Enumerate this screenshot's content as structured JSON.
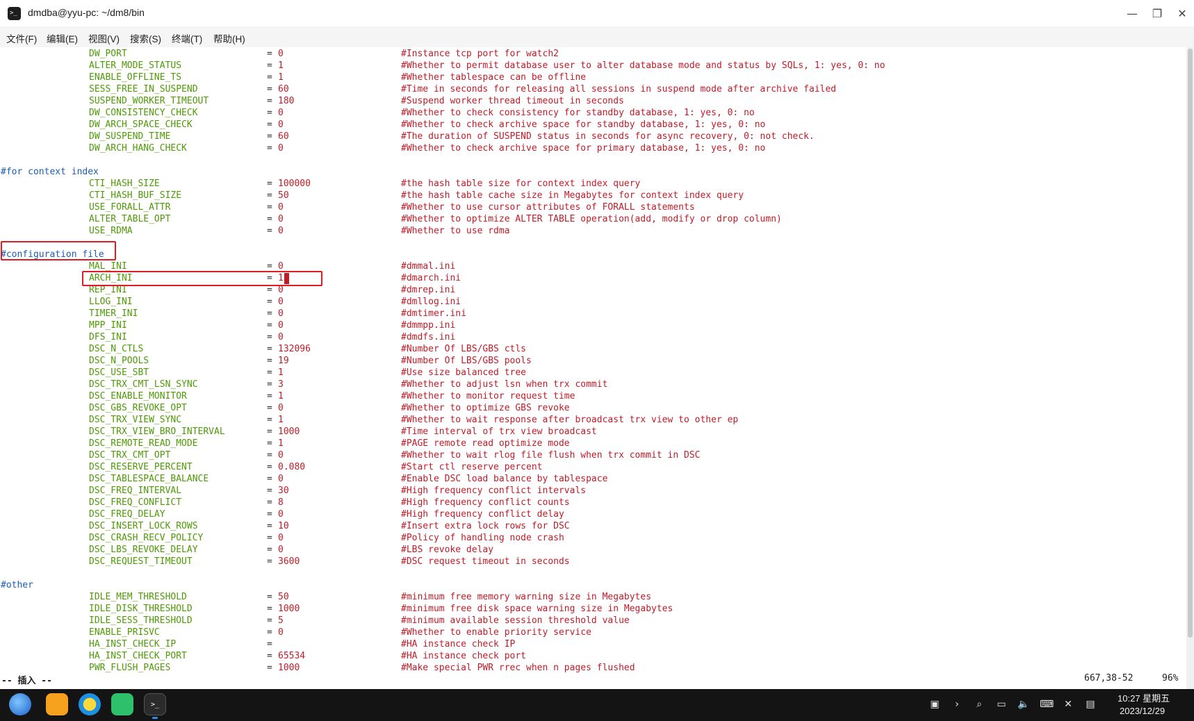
{
  "window": {
    "title": "dmdba@yyu-pc: ~/dm8/bin",
    "minimize_glyph": "—",
    "maximize_glyph": "❐",
    "close_glyph": "✕"
  },
  "menu": [
    "文件(F)",
    "编辑(E)",
    "视图(V)",
    "搜索(S)",
    "终端(T)",
    "帮助(H)"
  ],
  "lines": [
    {
      "name": "DW_PORT",
      "value": "0",
      "comment": "#Instance tcp port for watch2"
    },
    {
      "name": "ALTER_MODE_STATUS",
      "value": "1",
      "comment": "#Whether to permit database user to alter database mode and status by SQLs, 1: yes, 0: no"
    },
    {
      "name": "ENABLE_OFFLINE_TS",
      "value": "1",
      "comment": "#Whether tablespace can be offline"
    },
    {
      "name": "SESS_FREE_IN_SUSPEND",
      "value": "60",
      "comment": "#Time in seconds for releasing all sessions in suspend mode after archive failed"
    },
    {
      "name": "SUSPEND_WORKER_TIMEOUT",
      "value": "180",
      "comment": "#Suspend worker thread timeout in seconds"
    },
    {
      "name": "DW_CONSISTENCY_CHECK",
      "value": "0",
      "comment": "#Whether to check consistency for standby database, 1: yes, 0: no"
    },
    {
      "name": "DW_ARCH_SPACE_CHECK",
      "value": "0",
      "comment": "#Whether to check archive space for standby database, 1: yes, 0: no"
    },
    {
      "name": "DW_SUSPEND_TIME",
      "value": "60",
      "comment": "#The duration of SUSPEND status in seconds for async recovery, 0: not check."
    },
    {
      "name": "DW_ARCH_HANG_CHECK",
      "value": "0",
      "comment": "#Whether to check archive space for primary database, 1: yes, 0: no"
    },
    {
      "blank": true
    },
    {
      "section": "#for context index"
    },
    {
      "name": "CTI_HASH_SIZE",
      "value": "100000",
      "comment": "#the hash table size for context index query"
    },
    {
      "name": "CTI_HASH_BUF_SIZE",
      "value": "50",
      "comment": "#the hash table cache size in Megabytes for context index query"
    },
    {
      "name": "USE_FORALL_ATTR",
      "value": "0",
      "comment": "#Whether to use cursor attributes of FORALL statements"
    },
    {
      "name": "ALTER_TABLE_OPT",
      "value": "0",
      "comment": "#Whether to optimize ALTER TABLE operation(add, modify or drop column)"
    },
    {
      "name": "USE_RDMA",
      "value": "0",
      "comment": "#Whether to use rdma"
    },
    {
      "blank": true
    },
    {
      "section": "#configuration file"
    },
    {
      "name": "MAL_INI",
      "value": "0",
      "comment": "#dmmal.ini"
    },
    {
      "name": "ARCH_INI",
      "value": "1",
      "comment": "#dmarch.ini"
    },
    {
      "name": "REP_INI",
      "value": "0",
      "comment": "#dmrep.ini"
    },
    {
      "name": "LLOG_INI",
      "value": "0",
      "comment": "#dmllog.ini"
    },
    {
      "name": "TIMER_INI",
      "value": "0",
      "comment": "#dmtimer.ini"
    },
    {
      "name": "MPP_INI",
      "value": "0",
      "comment": "#dmmpp.ini"
    },
    {
      "name": "DFS_INI",
      "value": "0",
      "comment": "#dmdfs.ini"
    },
    {
      "name": "DSC_N_CTLS",
      "value": "132096",
      "comment": "#Number Of LBS/GBS ctls"
    },
    {
      "name": "DSC_N_POOLS",
      "value": "19",
      "comment": "#Number Of LBS/GBS pools"
    },
    {
      "name": "DSC_USE_SBT",
      "value": "1",
      "comment": "#Use size balanced tree"
    },
    {
      "name": "DSC_TRX_CMT_LSN_SYNC",
      "value": "3",
      "comment": "#Whether to adjust lsn when trx commit"
    },
    {
      "name": "DSC_ENABLE_MONITOR",
      "value": "1",
      "comment": "#Whether to monitor request time"
    },
    {
      "name": "DSC_GBS_REVOKE_OPT",
      "value": "0",
      "comment": "#Whether to optimize GBS revoke"
    },
    {
      "name": "DSC_TRX_VIEW_SYNC",
      "value": "1",
      "comment": "#Whether to wait response after broadcast trx view to other ep"
    },
    {
      "name": "DSC_TRX_VIEW_BRO_INTERVAL",
      "value": "1000",
      "comment": "#Time interval of trx view broadcast"
    },
    {
      "name": "DSC_REMOTE_READ_MODE",
      "value": "1",
      "comment": "#PAGE remote read optimize mode"
    },
    {
      "name": "DSC_TRX_CMT_OPT",
      "value": "0",
      "comment": "#Whether to wait rlog file flush when trx commit in DSC"
    },
    {
      "name": "DSC_RESERVE_PERCENT",
      "value": "0.080",
      "comment": "#Start ctl reserve percent"
    },
    {
      "name": "DSC_TABLESPACE_BALANCE",
      "value": "0",
      "comment": "#Enable DSC load balance by tablespace"
    },
    {
      "name": "DSC_FREQ_INTERVAL",
      "value": "30",
      "comment": "#High frequency conflict intervals"
    },
    {
      "name": "DSC_FREQ_CONFLICT",
      "value": "8",
      "comment": "#High frequency conflict counts"
    },
    {
      "name": "DSC_FREQ_DELAY",
      "value": "0",
      "comment": "#High frequency conflict delay"
    },
    {
      "name": "DSC_INSERT_LOCK_ROWS",
      "value": "10",
      "comment": "#Insert extra lock rows for DSC"
    },
    {
      "name": "DSC_CRASH_RECV_POLICY",
      "value": "0",
      "comment": "#Policy of handling node crash"
    },
    {
      "name": "DSC_LBS_REVOKE_DELAY",
      "value": "0",
      "comment": "#LBS revoke delay"
    },
    {
      "name": "DSC_REQUEST_TIMEOUT",
      "value": "3600",
      "comment": "#DSC request timeout in seconds"
    },
    {
      "blank": true
    },
    {
      "section": "#other"
    },
    {
      "name": "IDLE_MEM_THRESHOLD",
      "value": "50",
      "comment": "#minimum free memory warning size in Megabytes"
    },
    {
      "name": "IDLE_DISK_THRESHOLD",
      "value": "1000",
      "comment": "#minimum free disk space warning size in Megabytes"
    },
    {
      "name": "IDLE_SESS_THRESHOLD",
      "value": "5",
      "comment": "#minimum available session threshold value"
    },
    {
      "name": "ENABLE_PRISVC",
      "value": "0",
      "comment": "#Whether to enable priority service"
    },
    {
      "name": "HA_INST_CHECK_IP",
      "value": "",
      "comment": "#HA instance check IP"
    },
    {
      "name": "HA_INST_CHECK_PORT",
      "value": "65534",
      "comment": "#HA instance check port"
    },
    {
      "name": "PWR_FLUSH_PAGES",
      "value": "1000",
      "comment": "#Make special PWR rrec when n pages flushed"
    }
  ],
  "equals": "=",
  "status": {
    "mode": "-- 插入 --",
    "position": "667,38-52",
    "percent": "96%"
  },
  "taskbar": {
    "terminal_glyph": ">_",
    "tray": [
      "clipboard-icon",
      "chevron-right-icon",
      "search-icon",
      "screen-icon",
      "volume-icon",
      "keyboard-icon",
      "bluetooth-icon",
      "notification-icon"
    ],
    "tray_glyphs": [
      "▣",
      "›",
      "⌕",
      "▭",
      "🔈",
      "⌨",
      "✕",
      "▤"
    ],
    "time": "10:27 星期五",
    "date": "2023/12/29"
  },
  "colors": {
    "section": "#1a5fb4",
    "name": "#4e9a06",
    "value": "#c01c28",
    "highlight_box": "#e01b24"
  }
}
